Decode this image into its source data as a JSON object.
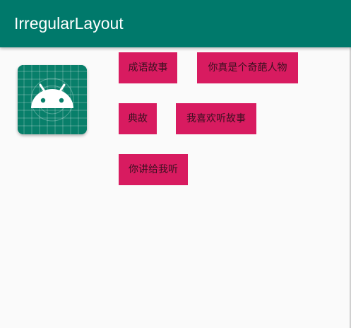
{
  "app_bar": {
    "title": "IrregularLayout",
    "color": "#00796b"
  },
  "launcher_icon": {
    "name": "android-icon",
    "background_color": "#087f6a",
    "foreground_color": "#ffffff"
  },
  "tags": [
    {
      "label": "成语故事"
    },
    {
      "label": "你真是个奇葩人物"
    },
    {
      "label": "典故"
    },
    {
      "label": "我喜欢听故事"
    },
    {
      "label": "你讲给我听"
    }
  ],
  "colors": {
    "tag_background": "#d81b60",
    "tag_text": "#3a1020",
    "page_background": "#fafafa"
  }
}
